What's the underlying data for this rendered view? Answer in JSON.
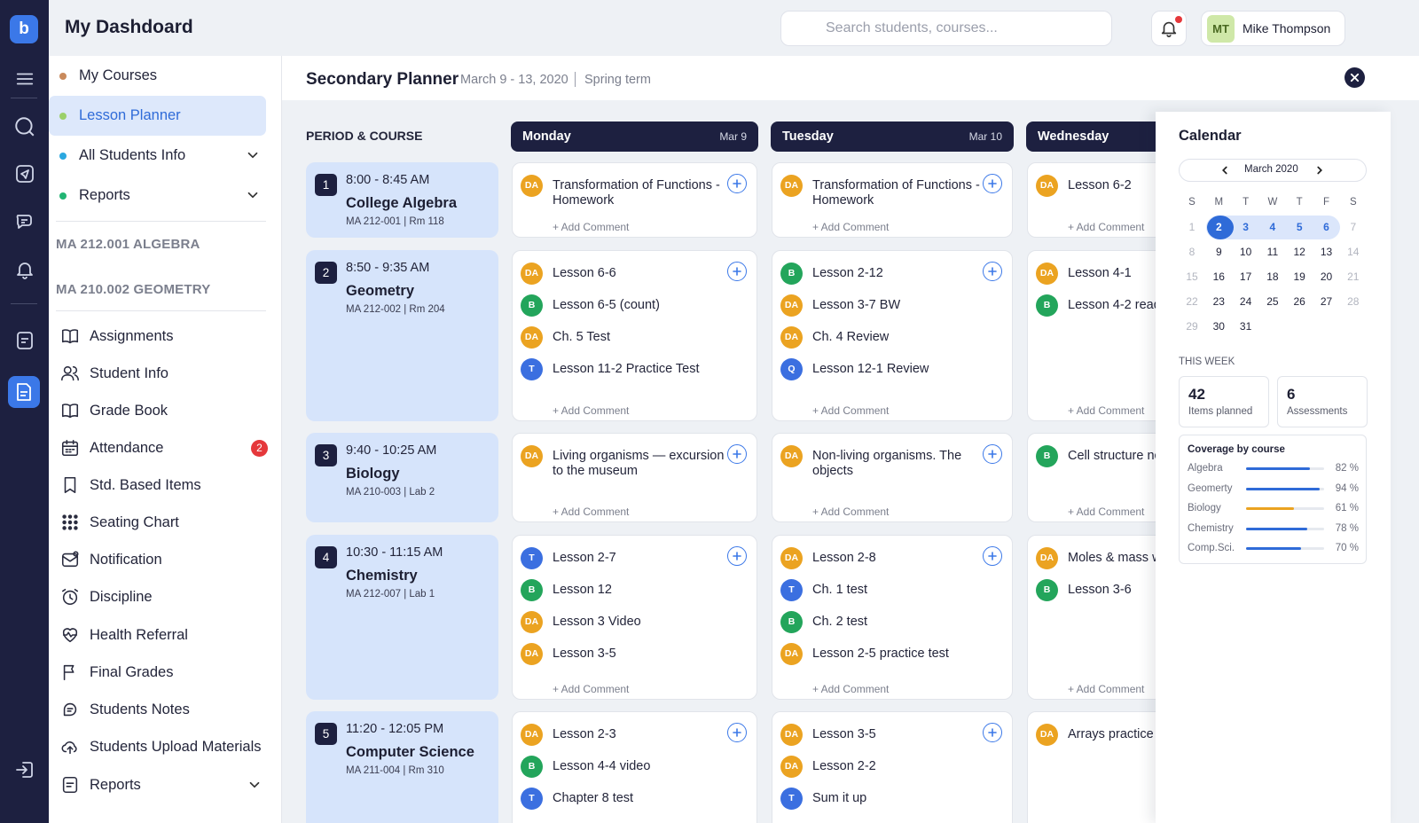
{
  "app": {
    "logo": "b",
    "title": "My Dashdoard"
  },
  "search": {
    "placeholder": "Search students, courses..."
  },
  "user": {
    "initials": "MT",
    "name": "Mike Thompson"
  },
  "nav": [
    {
      "label": "My Courses",
      "dot": "#c98a5c"
    },
    {
      "label": "Lesson Planner",
      "dot": "#9bd06a"
    },
    {
      "label": "All Students Info",
      "dot": "#2ba8e0"
    },
    {
      "label": "Reports",
      "dot": "#22b573"
    }
  ],
  "groups": [
    "MA 212.001 ALGEBRA",
    "MA 210.002 GEOMETRY"
  ],
  "links": [
    {
      "label": "Assignments",
      "icon": "book-icon"
    },
    {
      "label": "Student Info",
      "icon": "users-icon"
    },
    {
      "label": "Grade Book",
      "icon": "book-open-icon"
    },
    {
      "label": "Attendance",
      "icon": "calendar-icon",
      "badge": "2"
    },
    {
      "label": "Std. Based Items",
      "icon": "bookmark-icon"
    },
    {
      "label": "Seating Chart",
      "icon": "grid-dots-icon"
    },
    {
      "label": "Notification",
      "icon": "mail-notification-icon"
    },
    {
      "label": "Discipline",
      "icon": "alarm-icon"
    },
    {
      "label": "Health Referral",
      "icon": "heart-pulse-icon"
    },
    {
      "label": "Final Grades",
      "icon": "flag-icon"
    },
    {
      "label": "Students Notes",
      "icon": "note-icon"
    },
    {
      "label": "Students Upload Materials",
      "icon": "cloud-upload-icon"
    },
    {
      "label": "Reports",
      "icon": "report-icon"
    }
  ],
  "planner": {
    "title": "Secondary Planner",
    "dates": "March 9 - 13, 2020",
    "term": "Spring term",
    "col_label": "PERIOD & COURSE",
    "add_comment": "+ Add Comment"
  },
  "days": [
    {
      "name": "Monday",
      "date": "Mar 9"
    },
    {
      "name": "Tuesday",
      "date": "Mar 10"
    },
    {
      "name": "Wednesday",
      "date": ""
    }
  ],
  "periods": [
    {
      "num": "1",
      "time": "8:00 - 8:45 AM",
      "course": "College Algebra",
      "room": "MA 212-001 | Rm 118"
    },
    {
      "num": "2",
      "time": "8:50 - 9:35 AM",
      "course": "Geometry",
      "room": "MA 212-002 | Rm 204"
    },
    {
      "num": "3",
      "time": "9:40 - 10:25 AM",
      "course": "Biology",
      "room": "MA 210-003 | Lab 2"
    },
    {
      "num": "4",
      "time": "10:30 - 11:15 AM",
      "course": "Chemistry",
      "room": "MA 212-007 | Lab 1"
    },
    {
      "num": "5",
      "time": "11:20 - 12:05 PM",
      "course": "Computer Science",
      "room": "MA 211-004 | Rm 310"
    }
  ],
  "cells": [
    [
      [
        {
          "tag": "DA",
          "text": "Transformation of Functions - Homework"
        }
      ],
      [
        {
          "tag": "DA",
          "text": "Lesson 6-6"
        },
        {
          "tag": "B",
          "text": "Lesson 6-5 (count)"
        },
        {
          "tag": "DA",
          "text": "Ch. 5 Test"
        },
        {
          "tag": "T",
          "text": "Lesson 11-2 Practice Test"
        }
      ],
      [
        {
          "tag": "DA",
          "text": "Living organisms — excursion to the museum"
        }
      ],
      [
        {
          "tag": "T",
          "text": "Lesson 2-7"
        },
        {
          "tag": "B",
          "text": "Lesson 12"
        },
        {
          "tag": "DA",
          "text": "Lesson 3 Video"
        },
        {
          "tag": "DA",
          "text": "Lesson 3-5"
        }
      ],
      [
        {
          "tag": "DA",
          "text": "Lesson 2-3"
        },
        {
          "tag": "B",
          "text": "Lesson 4-4 video"
        },
        {
          "tag": "T",
          "text": "Chapter 8 test"
        }
      ]
    ],
    [
      [
        {
          "tag": "DA",
          "text": "Transformation of Functions - Homework"
        }
      ],
      [
        {
          "tag": "B",
          "text": "Lesson 2-12"
        },
        {
          "tag": "DA",
          "text": "Lesson 3-7 BW"
        },
        {
          "tag": "DA",
          "text": "Ch. 4 Review"
        },
        {
          "tag": "Q",
          "text": "Lesson 12-1 Review"
        }
      ],
      [
        {
          "tag": "DA",
          "text": "Non-living organisms. The objects"
        }
      ],
      [
        {
          "tag": "DA",
          "text": "Lesson 2-8"
        },
        {
          "tag": "T",
          "text": "Ch. 1 test"
        },
        {
          "tag": "B",
          "text": "Ch. 2 test"
        },
        {
          "tag": "DA",
          "text": "Lesson 2-5 practice test"
        }
      ],
      [
        {
          "tag": "DA",
          "text": "Lesson 3-5"
        },
        {
          "tag": "DA",
          "text": "Lesson 2-2"
        },
        {
          "tag": "T",
          "text": "Sum it up"
        }
      ]
    ],
    [
      [
        {
          "tag": "DA",
          "text": "Lesson 6-2"
        }
      ],
      [
        {
          "tag": "DA",
          "text": "Lesson 4-1"
        },
        {
          "tag": "B",
          "text": "Lesson 4-2 read"
        }
      ],
      [
        {
          "tag": "B",
          "text": "Cell structure no"
        }
      ],
      [
        {
          "tag": "DA",
          "text": "Moles & mass w"
        },
        {
          "tag": "B",
          "text": "Lesson 3-6"
        }
      ],
      [
        {
          "tag": "DA",
          "text": "Arrays practice"
        }
      ]
    ]
  ],
  "calendar": {
    "title": "Calendar",
    "month": "March 2020",
    "dow": [
      "S",
      "M",
      "T",
      "W",
      "T",
      "F",
      "S"
    ],
    "weeks": [
      [
        "1",
        "2",
        "3",
        "4",
        "5",
        "6",
        "7"
      ],
      [
        "8",
        "9",
        "10",
        "11",
        "12",
        "13",
        "14"
      ],
      [
        "15",
        "16",
        "17",
        "18",
        "19",
        "20",
        "21"
      ],
      [
        "22",
        "23",
        "24",
        "25",
        "26",
        "27",
        "28"
      ],
      [
        "29",
        "30",
        "31",
        "",
        "",
        "",
        ""
      ]
    ],
    "selected": "2",
    "week_highlight": [
      "2",
      "3",
      "4",
      "5",
      "6"
    ],
    "this_week_label": "THIS WEEK",
    "stats": [
      {
        "value": "42",
        "label": "Items planned"
      },
      {
        "value": "6",
        "label": "Assessments"
      }
    ],
    "coverage_title": "Coverage by course",
    "coverage": [
      {
        "course": "Algebra",
        "pct": 82,
        "label": "82 %",
        "color": "#2f6bd8"
      },
      {
        "course": "Geomerty",
        "pct": 94,
        "label": "94 %",
        "color": "#2f6bd8"
      },
      {
        "course": "Biology",
        "pct": 61,
        "label": "61 %",
        "color": "#eba321"
      },
      {
        "course": "Chemistry",
        "pct": 78,
        "label": "78 %",
        "color": "#2f6bd8"
      },
      {
        "course": "Comp.Sci.",
        "pct": 70,
        "label": "70 %",
        "color": "#2f6bd8"
      }
    ]
  }
}
